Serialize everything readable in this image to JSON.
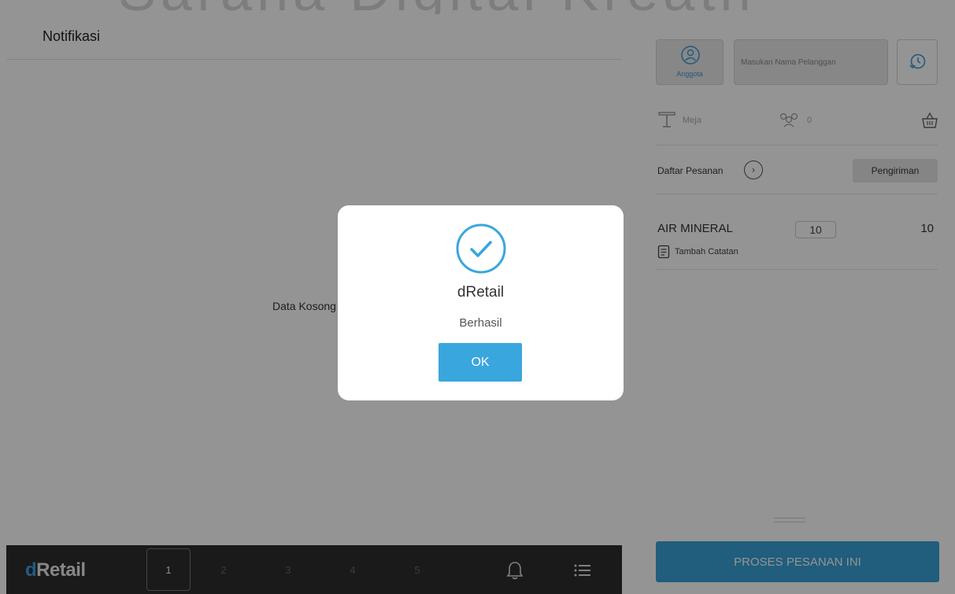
{
  "app": {
    "brand": "dRetail",
    "brand_d": "d",
    "brand_rest": "Retail"
  },
  "notifications": {
    "title": "Notifikasi",
    "empty_text": "Data Kosong"
  },
  "bottom_bar": {
    "tabs": [
      {
        "label": "1",
        "active": true
      },
      {
        "label": "2",
        "active": false
      },
      {
        "label": "3",
        "active": false
      },
      {
        "label": "4",
        "active": false
      },
      {
        "label": "5",
        "active": false
      }
    ],
    "icons": [
      "bell-icon",
      "menu-list-icon"
    ]
  },
  "order_panel": {
    "member_label": "Anggota",
    "customer_placeholder": "Masukan Nama Pelanggan",
    "table_label": "Meja",
    "guest_count": "0",
    "order_list_label": "Daftar Pesanan",
    "delivery_label": "Pengiriman",
    "items": [
      {
        "name": "AIR MINERAL",
        "qty": "10",
        "total": "10",
        "note_label": "Tambah Catatan"
      }
    ],
    "process_label": "PROSES PESANAN INI"
  },
  "dialog": {
    "title": "dRetail",
    "message": "Berhasil",
    "ok_label": "OK"
  },
  "colors": {
    "accent": "#39a6de",
    "bar": "#2d2d2d",
    "overlay": "rgba(0,0,0,0.42)"
  }
}
